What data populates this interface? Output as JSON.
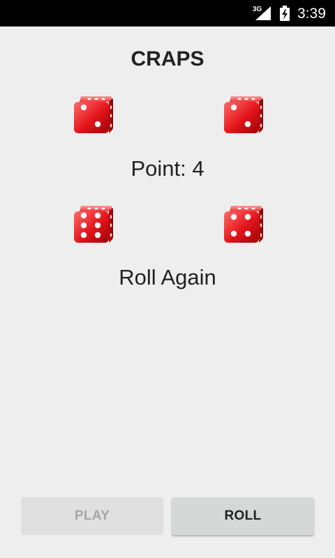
{
  "status_bar": {
    "network": "3G",
    "time": "3:39"
  },
  "app": {
    "title": "CRAPS",
    "point_text": "Point: 4",
    "result_text": "Roll Again",
    "dice": [
      {
        "name": "point-die-1",
        "face": 2
      },
      {
        "name": "point-die-2",
        "face": 2
      },
      {
        "name": "roll-die-1",
        "face": 6
      },
      {
        "name": "roll-die-2",
        "face": 4
      }
    ],
    "buttons": {
      "play_label": "PLAY",
      "play_enabled": false,
      "roll_label": "ROLL",
      "roll_enabled": true
    }
  },
  "colors": {
    "die_red": "#e3141b",
    "background": "#eeeeee"
  }
}
